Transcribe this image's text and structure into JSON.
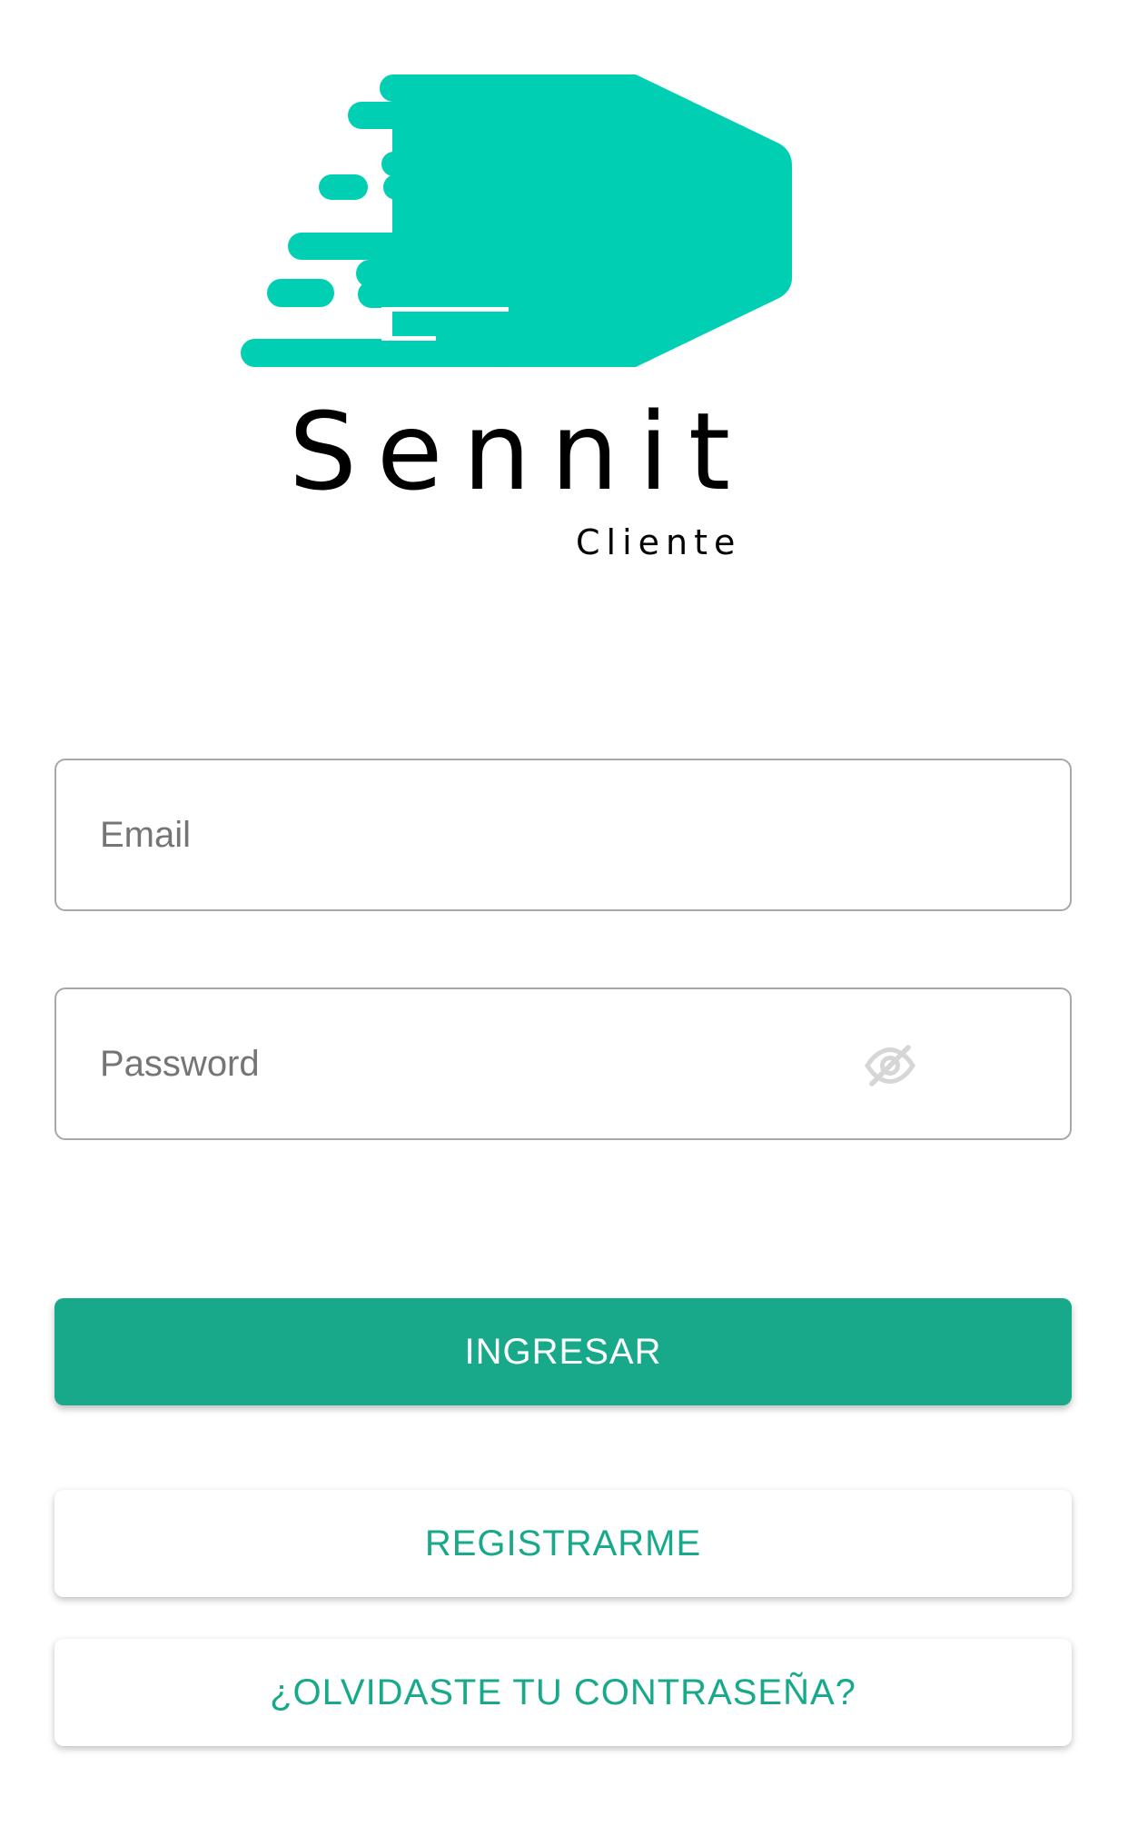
{
  "brand": {
    "name": "Sennit",
    "subtitle": "Cliente",
    "accent_color": "#00cfb4",
    "primary_color": "#18a98b"
  },
  "form": {
    "email": {
      "placeholder": "Email",
      "value": ""
    },
    "password": {
      "placeholder": "Password",
      "value": "",
      "toggle_icon": "eye-off-icon"
    }
  },
  "actions": {
    "login_label": "INGRESAR",
    "register_label": "REGISTRARME",
    "forgot_label": "¿OLVIDASTE TU CONTRASEÑA?"
  }
}
